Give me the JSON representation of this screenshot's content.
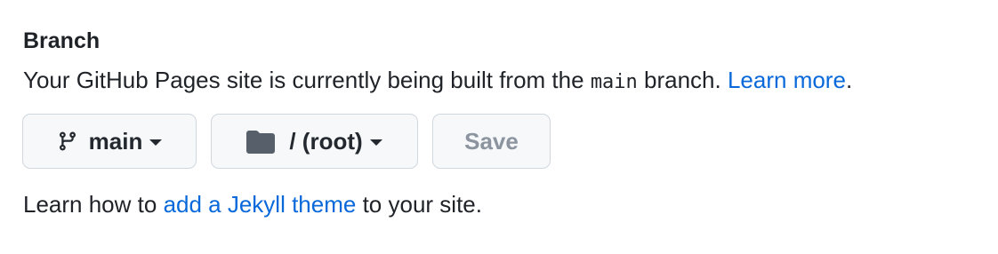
{
  "branch_section": {
    "heading": "Branch",
    "description_prefix": "Your GitHub Pages site is currently being built from the ",
    "branch_code": "main",
    "description_suffix": " branch. ",
    "learn_more_label": "Learn more",
    "description_end": "."
  },
  "controls": {
    "branch_select": {
      "icon": "git-branch-icon",
      "value": "main"
    },
    "folder_select": {
      "icon": "folder-icon",
      "value": "/ (root)"
    },
    "save_label": "Save"
  },
  "footer": {
    "prefix": "Learn how to ",
    "link_label": "add a Jekyll theme",
    "suffix": " to your site."
  },
  "colors": {
    "link": "#0969da",
    "text": "#1f2328",
    "button_bg": "#f6f8fa",
    "button_border": "#d0d7de",
    "disabled_text": "#8c959f"
  }
}
